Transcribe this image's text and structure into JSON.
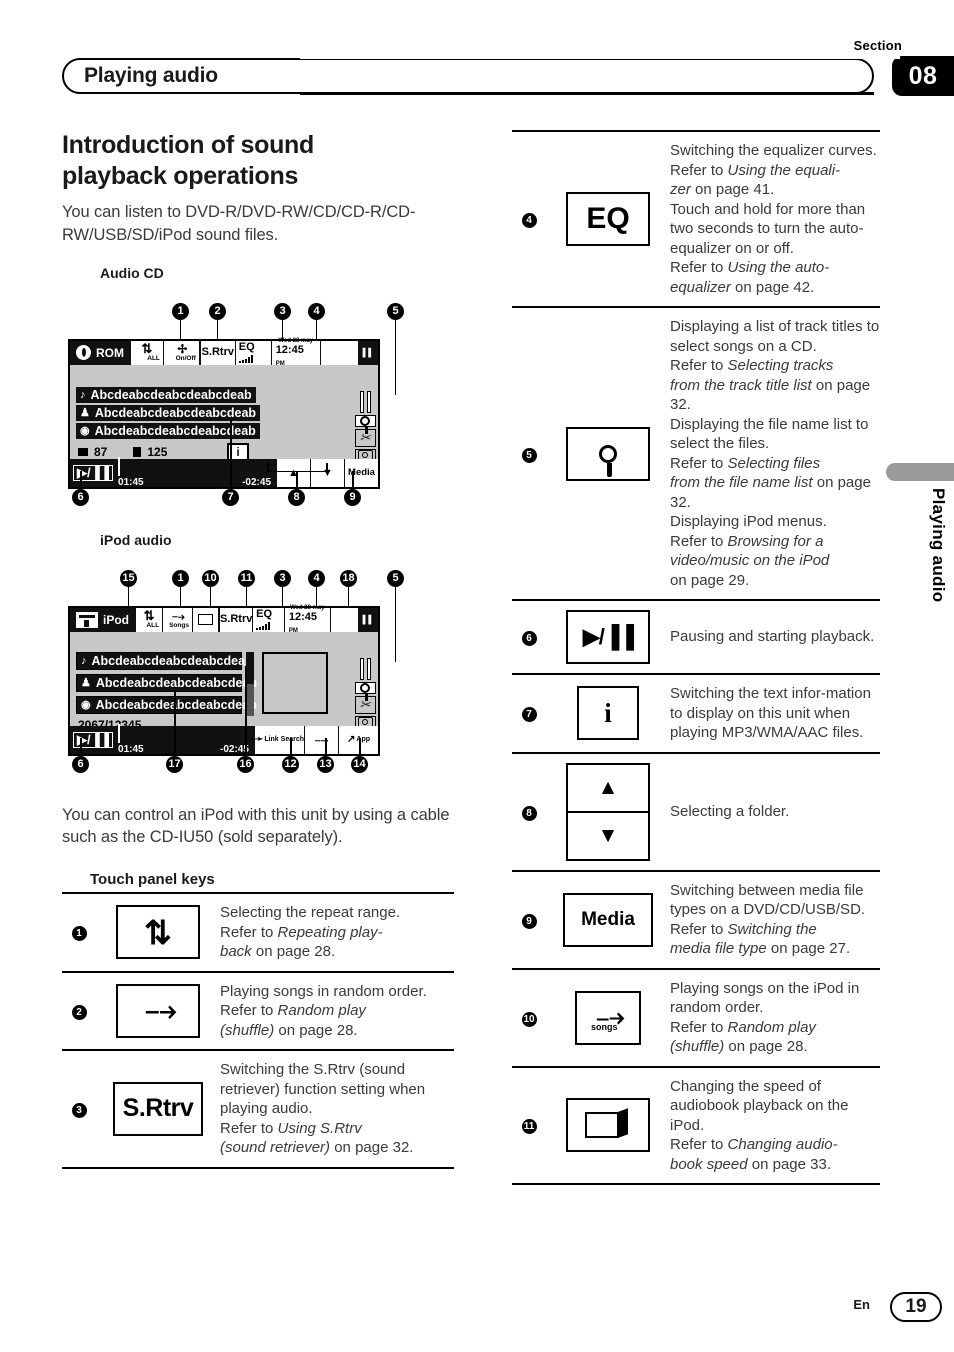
{
  "header": {
    "section_word": "Section",
    "section_number": "08",
    "title": "Playing audio"
  },
  "side_tab_text": "Playing audio",
  "footer": {
    "lang": "En",
    "page": "19"
  },
  "main": {
    "heading_line1": "Introduction of sound",
    "heading_line2": "playback operations",
    "intro": "You can listen to DVD-R/DVD-RW/CD/CD-R/CD-RW/USB/SD/iPod sound files.",
    "audio_cd_label": "Audio CD",
    "ipod_label": "iPod audio",
    "ipod_note": "You can control an iPod with this unit by using a cable such as the CD-IU50 (sold separately).",
    "touch_panel_heading": "Touch panel keys"
  },
  "audio_cd_screen": {
    "source": "ROM",
    "repeat_label": "ALL",
    "shuffle_label": "On/Off",
    "srtrv": "S.Rtrv",
    "eq": "EQ",
    "clock_date": "Wed 28 may",
    "clock_time": "12:45",
    "clock_ampm": "PM",
    "rows": [
      "Abcdeabcdeabcdeabcdeab",
      "Abcdeabcdeabcdeabcdeab",
      "Abcdeabcdeabcdeabcdeab"
    ],
    "folder_count": "87",
    "file_count": "125",
    "info_key": "i",
    "elapsed": "01:45",
    "remain": "-02:45",
    "playpause": "▶/▐▐",
    "up": "▲",
    "down": "▼",
    "media": "Media",
    "callouts": [
      "1",
      "2",
      "3",
      "4",
      "5",
      "6",
      "7",
      "8",
      "9"
    ]
  },
  "ipod_screen": {
    "source": "iPod",
    "repeat_label": "ALL",
    "shuffle_label": "Songs",
    "srtrv": "S.Rtrv",
    "eq": "EQ",
    "clock_date": "Wed 28 may",
    "clock_time": "12:45",
    "clock_ampm": "PM",
    "rows": [
      "Abcdeabcdeabcdeabcdeab",
      "Abcdeabcdeabcdeabcdeab",
      "Abcdeabcdeabcdeabcdeab"
    ],
    "track_counter": "2067/12345",
    "elapsed": "01:45",
    "remain": "-02:45",
    "playpause": "▶/▐▐",
    "link_search": "Link Search",
    "app": "App",
    "callouts": [
      "15",
      "1",
      "10",
      "11",
      "3",
      "4",
      "18",
      "5",
      "6",
      "17",
      "16",
      "12",
      "13",
      "14"
    ]
  },
  "keys_left": [
    {
      "num": "1",
      "icon": "repeat-icon",
      "icon_text": "",
      "lines": [
        {
          "t": "Selecting the repeat range."
        },
        {
          "t": "Refer to "
        },
        {
          "t": "Repeating play-back",
          "i": true
        },
        {
          "t": " on page 28."
        }
      ],
      "desc_html": "Selecting the repeat range.<br>Refer to <em>Repeating play-<br>back</em> on page 28."
    },
    {
      "num": "2",
      "icon": "shuffle-icon",
      "desc_html": "Playing songs in random order.<br>Refer to <em>Random play<br>(shuffle)</em> on page 28."
    },
    {
      "num": "3",
      "icon": "srtrv-label",
      "icon_text": "S.Rtrv",
      "desc_html": "Switching the S.Rtrv (sound retriever) function setting when playing audio.<br>Refer to <em>Using S.Rtrv<br>(sound retriever)</em> on page 32."
    }
  ],
  "keys_right": [
    {
      "num": "4",
      "icon": "eq-label",
      "icon_text": "EQ",
      "desc_html": "Switching the equalizer curves.<br>Refer to <em>Using the equali-<br>zer</em> on page 41.<br>Touch and hold for more than two seconds to turn the auto-equalizer on or off.<br>Refer to <em>Using the auto-<br>equalizer</em> on page 42."
    },
    {
      "num": "5",
      "icon": "magnifier-icon",
      "desc_html": "Displaying a list of track titles to select songs on a CD.<br>Refer to <em>Selecting tracks<br>from the track title list</em> on page 32.<br>Displaying the file name list to select the files.<br>Refer to <em>Selecting files<br>from the file name list</em> on page 32.<br>Displaying iPod menus.<br>Refer to <em>Browsing for a<br>video/music on the iPod</em><br>on page 29."
    },
    {
      "num": "6",
      "icon": "play-pause-icon",
      "icon_text": "▶/▐▐",
      "desc_html": "Pausing and starting playback."
    },
    {
      "num": "7",
      "icon": "info-icon",
      "icon_text": "i",
      "desc_html": "Switching the text infor-mation to display on this unit when playing MP3/WMA/AAC files."
    },
    {
      "num": "8",
      "icon": "up-down-arrows-icon",
      "desc_html": "Selecting a folder."
    },
    {
      "num": "9",
      "icon": "media-label",
      "icon_text": "Media",
      "desc_html": "Switching between media file types on a DVD/CD/USB/SD.<br>Refer to <em>Switching the<br>media file type</em> on page 27."
    },
    {
      "num": "10",
      "icon": "shuffle-songs-icon",
      "icon_text": "songs",
      "desc_html": "Playing songs on the iPod in random order.<br>Refer to <em>Random play<br>(shuffle)</em> on page 28."
    },
    {
      "num": "11",
      "icon": "audiobook-icon",
      "desc_html": "Changing the speed of audiobook playback on the iPod.<br>Refer to <em>Changing audio-<br>book speed</em> on page 33."
    }
  ]
}
